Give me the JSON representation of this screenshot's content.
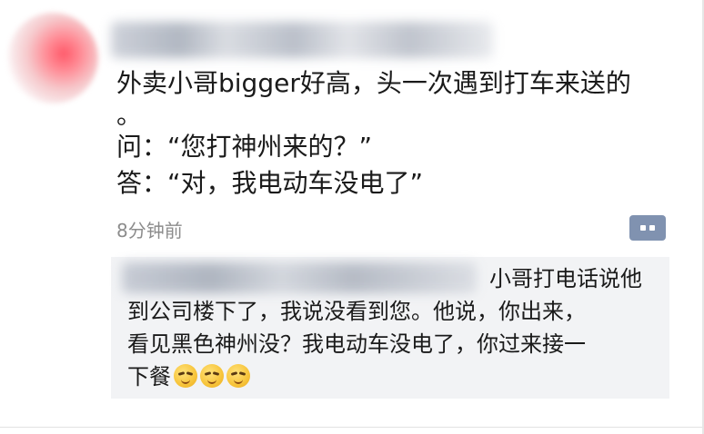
{
  "post": {
    "text_line1": "外卖小哥bigger好高，头一次遇到打车来送的",
    "text_line2": "。",
    "text_line3": "问：“您打神州来的？”",
    "text_line4": "答：“对，我电动车没电了”",
    "timestamp": "8分钟前",
    "comment_icon": "comment-bubble-icon"
  },
  "comment": {
    "line1": "小哥打电话说他",
    "line2": "到公司楼下了，我说没看到您。他说，你出来，",
    "line3": "看见黑色神州没？我电动车没电了，你过来接一",
    "line4": "下餐",
    "emojis": [
      "smirk-emoji",
      "smirk-emoji",
      "smirk-emoji"
    ]
  },
  "colors": {
    "text": "#1a1a1a",
    "timestamp": "#8c8c8c",
    "comment_bg": "#f2f3f5",
    "comment_button": "#8092b0"
  }
}
